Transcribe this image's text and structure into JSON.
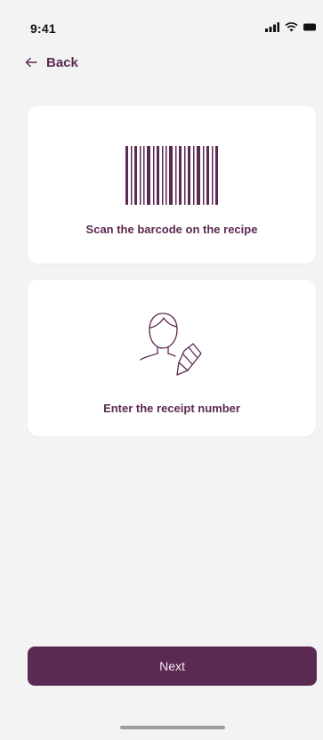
{
  "status_bar": {
    "time": "9:41",
    "icons": [
      "signal-icon",
      "wifi-icon",
      "battery-icon"
    ]
  },
  "header": {
    "back_label": "Back",
    "back_icon": "arrow-left-icon"
  },
  "options": [
    {
      "label": "Scan the barcode on the recipe",
      "icon": "barcode-icon"
    },
    {
      "label": "Enter the receipt number",
      "icon": "person-pencil-icon"
    }
  ],
  "footer": {
    "next_label": "Next"
  },
  "colors": {
    "brand": "#5b2a52",
    "background": "#f3f3f3",
    "card": "#ffffff"
  }
}
